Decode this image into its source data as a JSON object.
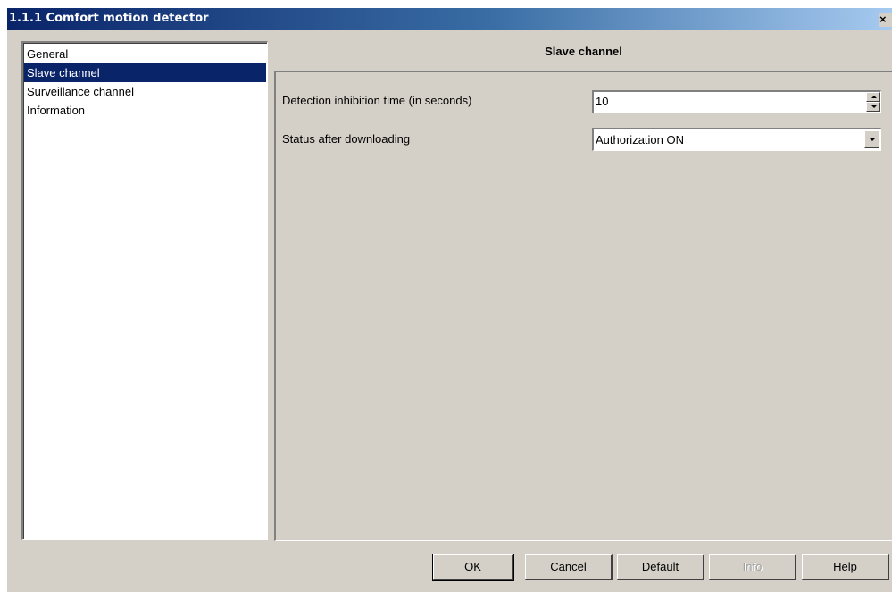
{
  "window": {
    "title": "1.1.1 Comfort motion detector",
    "close_glyph": "×"
  },
  "nav": {
    "items": [
      {
        "label": "General"
      },
      {
        "label": "Slave channel"
      },
      {
        "label": "Surveillance channel"
      },
      {
        "label": "Information"
      }
    ],
    "selected": "Slave channel"
  },
  "panel": {
    "heading": "Slave channel",
    "params": [
      {
        "label": "Detection inhibition time (in seconds)",
        "value": "10",
        "control": "spinner"
      },
      {
        "label": "Status after downloading",
        "value": "Authorization ON",
        "control": "dropdown"
      }
    ]
  },
  "buttons": {
    "ok": "OK",
    "cancel": "Cancel",
    "default": "Default",
    "info": "Info",
    "help": "Help"
  },
  "colors": {
    "titlebar_start": "#0a246a",
    "titlebar_end": "#a6caf0",
    "face": "#d4d0c8",
    "selection": "#0a246a"
  }
}
